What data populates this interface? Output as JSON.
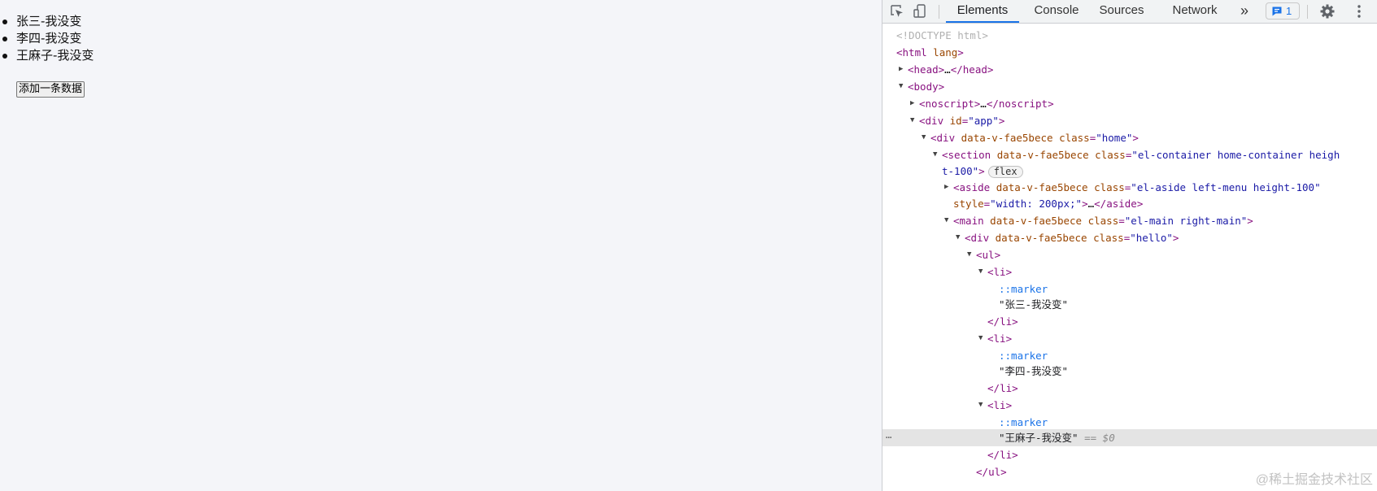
{
  "preview": {
    "list_items": [
      "张三-我没变",
      "李四-我没变",
      "王麻子-我没变"
    ],
    "add_button_label": "添加一条数据"
  },
  "devtools": {
    "tabs": [
      "Elements",
      "Console",
      "Sources",
      "Network"
    ],
    "active_tab": "Elements",
    "more_tabs_symbol": "»",
    "issues_count": "1",
    "icons": [
      "inspect-element-icon",
      "device-toolbar-icon",
      "more-tabs-icon",
      "issues-icon",
      "settings-gear-icon",
      "more-options-icon"
    ],
    "selected_indicator": "== $0",
    "gutter_dots": "⋯",
    "dom_lines": {
      "doctype": "<!DOCTYPE html>",
      "html_open": "html",
      "html_attr": "lang",
      "head": "head",
      "head_collapsed": "…",
      "body": "body",
      "noscript": "noscript",
      "div_app_tag": "div",
      "div_app_attr": "id",
      "div_app_val": "\"app\"",
      "div_home_tag": "div",
      "scoped_attr": "data-v-fae5bece",
      "class_attr": "class",
      "div_home_val": "\"home\"",
      "section_tag": "section",
      "section_class_val_1": "\"el-container home-container heigh",
      "section_class_val_2": "t-100\"",
      "flex_badge": "flex",
      "aside_tag": "aside",
      "aside_class_val": "\"el-aside left-menu height-100\"",
      "aside_style_attr": "style",
      "aside_style_val": "\"width: 200px;\"",
      "main_tag": "main",
      "main_class_val": "\"el-main right-main\"",
      "div_hello_tag": "div",
      "div_hello_val": "\"hello\"",
      "ul_tag": "ul",
      "li_tag": "li",
      "marker": "::marker",
      "text_1": "\"张三-我没变\"",
      "text_2": "\"李四-我没变\"",
      "text_3": "\"王麻子-我没变\""
    }
  },
  "watermark": "@稀土掘金技术社区"
}
